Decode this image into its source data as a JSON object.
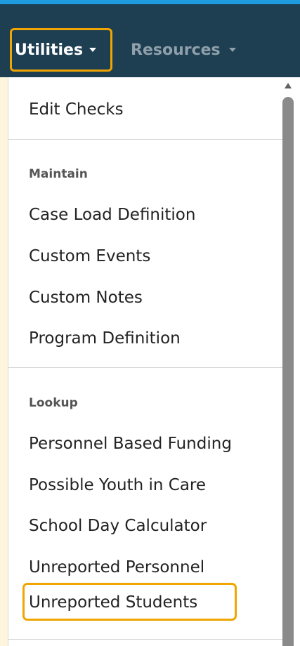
{
  "navbar": {
    "utilities_label": "Utilities",
    "resources_label": "Resources"
  },
  "menu": {
    "edit_checks": "Edit Checks",
    "maintain_header": "Maintain",
    "maintain_items": [
      "Case Load Definition",
      "Custom Events",
      "Custom Notes",
      "Program Definition"
    ],
    "lookup_header": "Lookup",
    "lookup_items": [
      "Personnel Based Funding",
      "Possible Youth in Care",
      "School Day Calculator",
      "Unreported Personnel",
      "Unreported Students"
    ]
  },
  "colors": {
    "navbar": "#1e3e52",
    "top_stripe": "#1f9be0",
    "highlight": "#f0a500",
    "background": "#fdf6dc"
  },
  "icons": {
    "dropdown": "caret-down-icon",
    "scroll_up": "scroll-up-arrow-icon"
  }
}
